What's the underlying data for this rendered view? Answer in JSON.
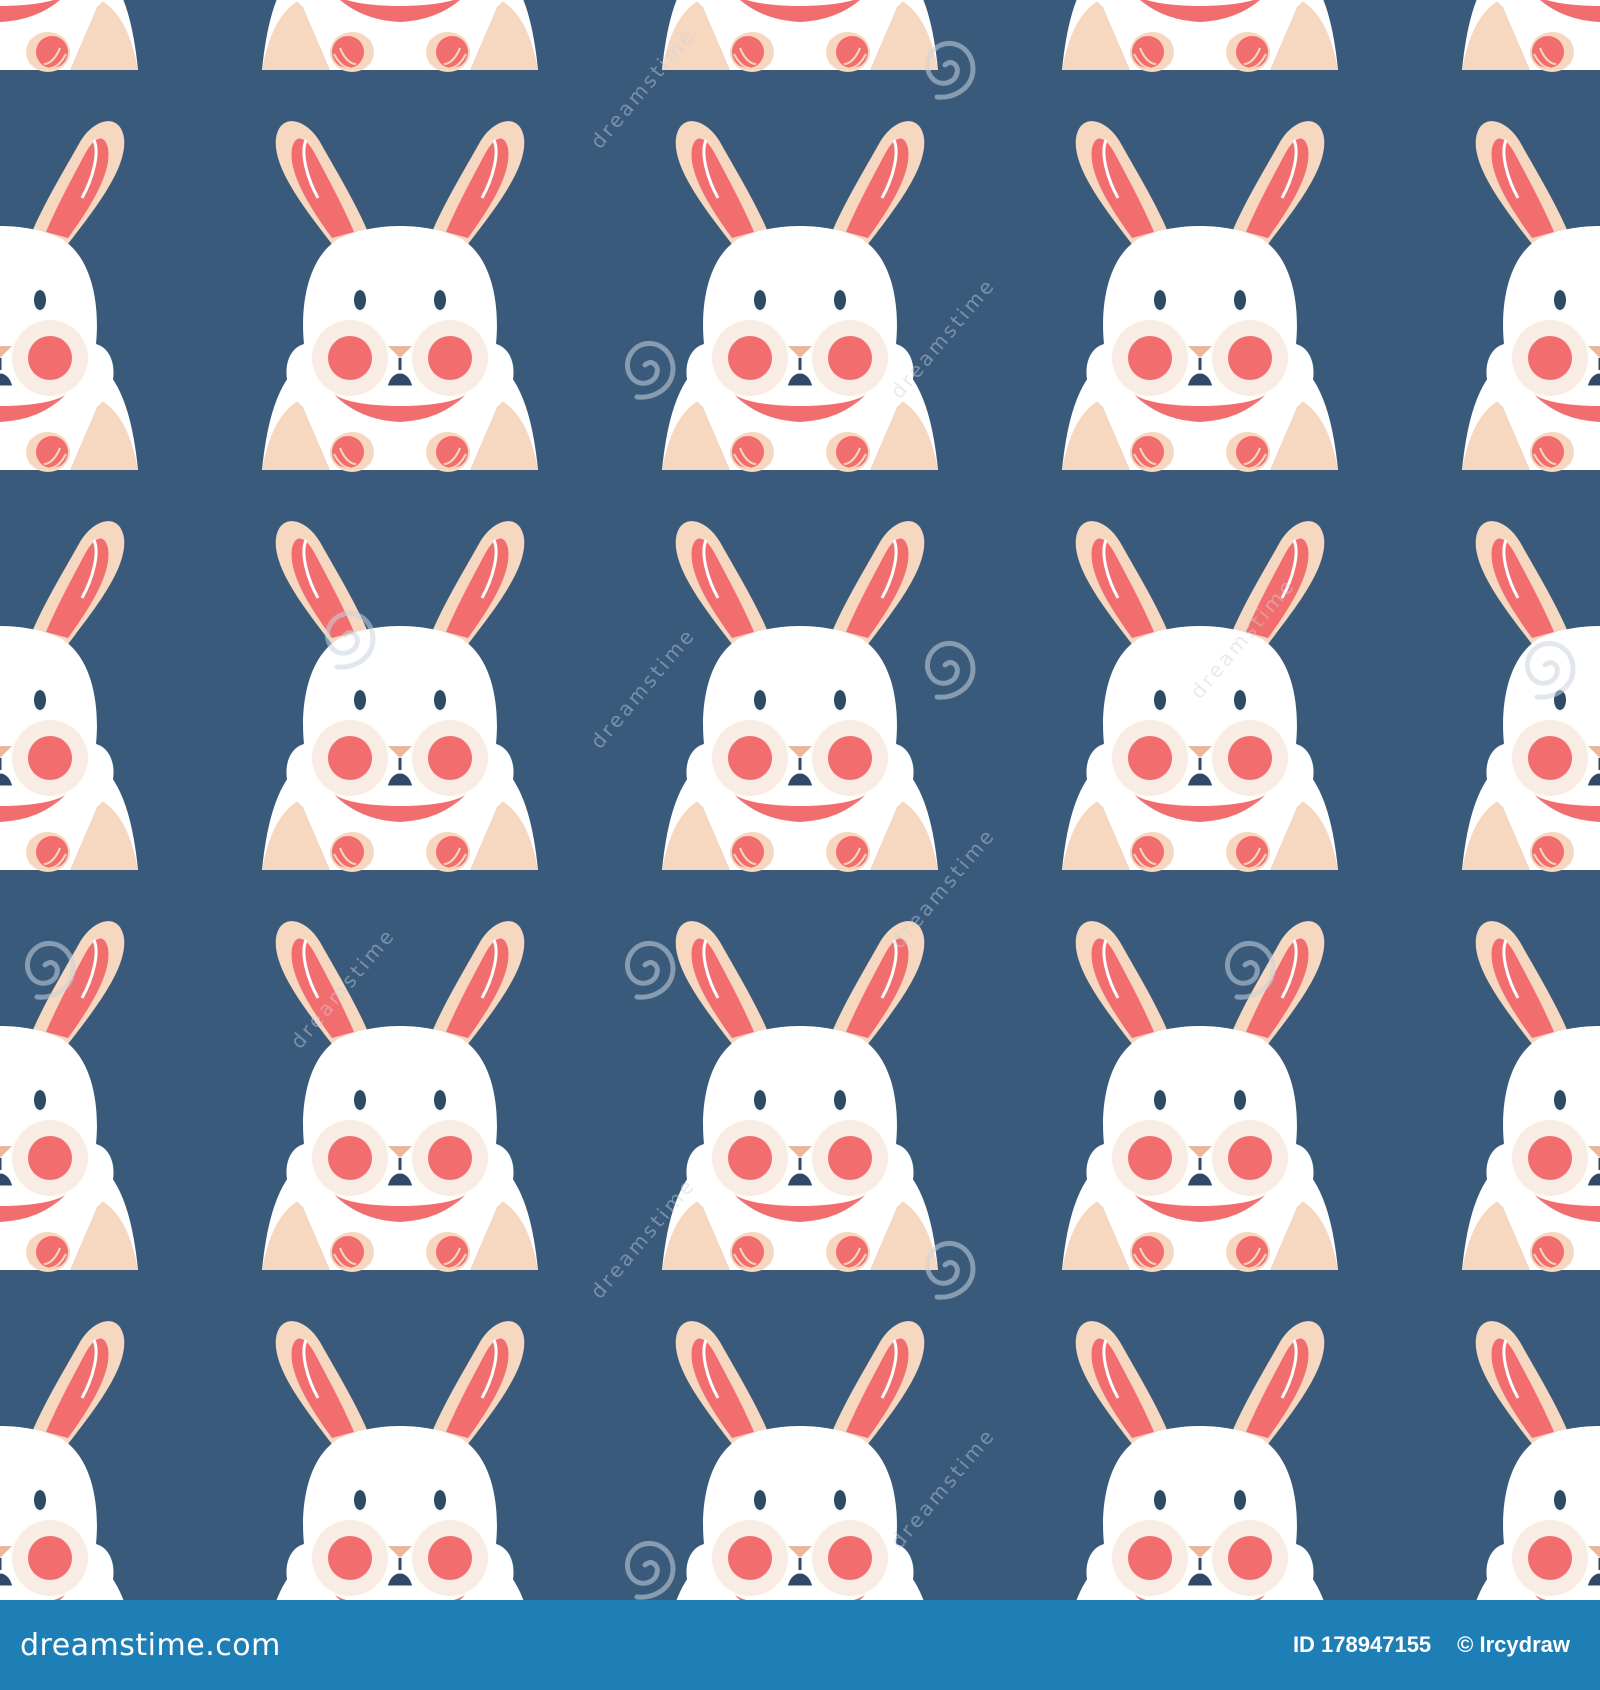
{
  "colors": {
    "background": "#3a5a7b",
    "footer": "#1d7fb6",
    "body": "#ffffff",
    "fur": "#f6d7bf",
    "pink": "#f26d6e",
    "ink": "#2f4a66",
    "watermark": "#c9d3df"
  },
  "pattern": {
    "subject": "white rabbit with pink cheeks and collar, front paws resting",
    "repeat": "grid"
  },
  "watermark": {
    "text": "dreamstime",
    "icon": "spiral-logo-icon"
  },
  "footer": {
    "brand": "dreamstime.com",
    "image_id": "ID 178947155",
    "author": "© Ircydraw"
  }
}
